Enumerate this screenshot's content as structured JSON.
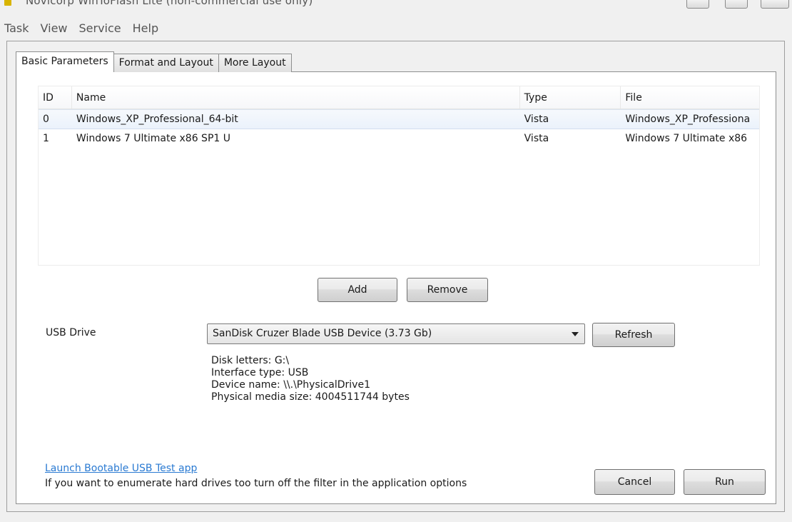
{
  "window": {
    "title": "Novicorp WinToFlash Lite (non-commercial use only)"
  },
  "menu": {
    "items": [
      "Task",
      "View",
      "Service",
      "Help"
    ]
  },
  "tabs": [
    {
      "label": "Basic Parameters",
      "active": true
    },
    {
      "label": "Format and Layout",
      "active": false
    },
    {
      "label": "More Layout",
      "active": false
    }
  ],
  "list": {
    "columns": [
      "ID",
      "Name",
      "Type",
      "File"
    ],
    "rows": [
      {
        "id": "0",
        "name": "Windows_XP_Professional_64-bit",
        "type": "Vista",
        "file": "Windows_XP_Professiona",
        "selected": true
      },
      {
        "id": "1",
        "name": "Windows 7 Ultimate x86 SP1 U",
        "type": "Vista",
        "file": "Windows 7 Ultimate x86",
        "selected": false
      }
    ]
  },
  "buttons": {
    "add": "Add",
    "remove": "Remove",
    "refresh": "Refresh",
    "cancel": "Cancel",
    "run": "Run"
  },
  "usb": {
    "label": "USB Drive",
    "selected": "SanDisk Cruzer Blade USB Device (3.73 Gb)",
    "info": [
      "Disk letters: G:\\",
      "Interface type: USB",
      "Device name: \\\\.\\PhysicalDrive1",
      "Physical media size: 4004511744 bytes"
    ]
  },
  "footer": {
    "link": "Launch Bootable USB Test app",
    "hint": "If you want to enumerate hard drives too turn off the filter in the application options"
  },
  "colors": {
    "link": "#2a7ad2",
    "selection": "#ebf2fb",
    "background": "#f0f0f0"
  }
}
